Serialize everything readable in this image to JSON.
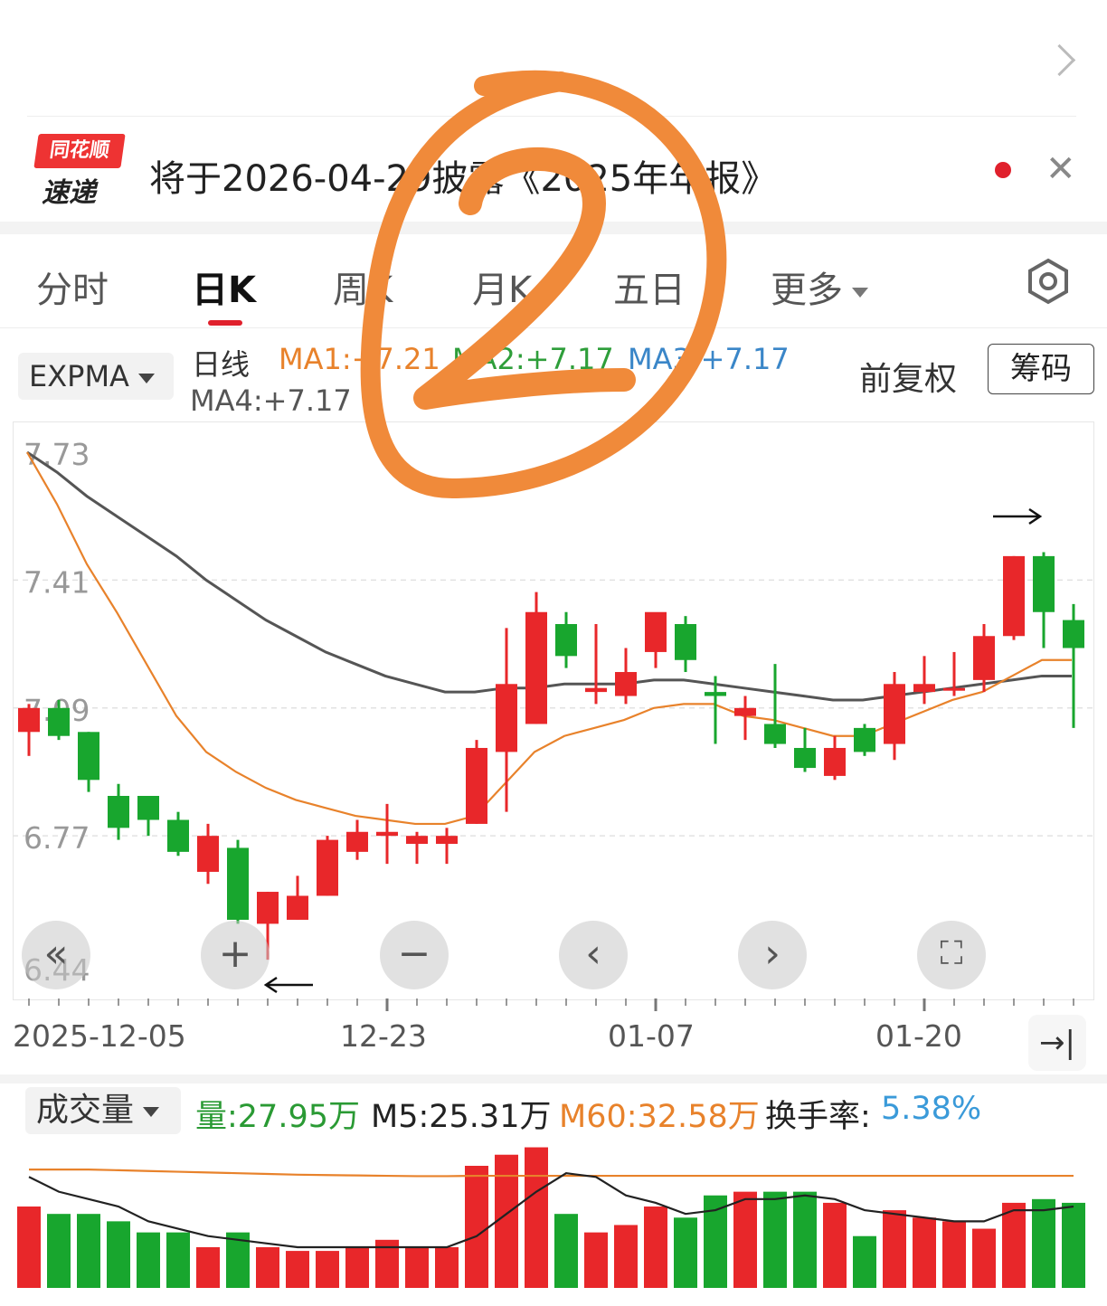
{
  "news": {
    "logo_top": "同花顺",
    "logo_bottom": "速递",
    "text": "将于2026-04-29披露《2025年年报》",
    "close": "✕"
  },
  "tabs": [
    "分时",
    "日K",
    "周K",
    "月K",
    "五日",
    "更多"
  ],
  "active_tab": "日K",
  "indicator": {
    "name": "EXPMA",
    "label": "日线",
    "ma1": "MA1:+7.21",
    "ma2": "MA2:+7.17",
    "ma3": "MA3:+7.17",
    "ma4": "MA4:+7.17",
    "adjust": "前复权",
    "chips_button": "筹码"
  },
  "colors": {
    "up": "#e8272a",
    "down": "#18a62e",
    "ma1": "#e8822b",
    "ma_dark": "#555555",
    "annotation": "#f08a3a"
  },
  "icons": [
    "gear-icon",
    "chevron-right-icon",
    "close-icon",
    "jump-to-end-icon"
  ],
  "controls": [
    "«",
    "+",
    "−",
    "‹",
    "›",
    "⛶"
  ],
  "chart_data": [
    {
      "type": "candlestick",
      "y_ticks": [
        "7.73",
        "7.41",
        "7.09",
        "6.77",
        "6.44"
      ],
      "ylim": [
        6.44,
        7.73
      ],
      "x_labels": [
        "2025-12-05",
        "12-23",
        "01-07",
        "01-20"
      ],
      "candles": [
        {
          "o": 7.03,
          "h": 7.1,
          "l": 6.97,
          "c": 7.09
        },
        {
          "o": 7.09,
          "h": 7.11,
          "l": 7.01,
          "c": 7.02
        },
        {
          "o": 7.03,
          "h": 7.03,
          "l": 6.88,
          "c": 6.91
        },
        {
          "o": 6.87,
          "h": 6.9,
          "l": 6.76,
          "c": 6.79
        },
        {
          "o": 6.87,
          "h": 6.87,
          "l": 6.77,
          "c": 6.81
        },
        {
          "o": 6.81,
          "h": 6.83,
          "l": 6.72,
          "c": 6.73
        },
        {
          "o": 6.68,
          "h": 6.8,
          "l": 6.65,
          "c": 6.77
        },
        {
          "o": 6.74,
          "h": 6.76,
          "l": 6.55,
          "c": 6.56
        },
        {
          "o": 6.55,
          "h": 6.63,
          "l": 6.46,
          "c": 6.63
        },
        {
          "o": 6.56,
          "h": 6.67,
          "l": 6.56,
          "c": 6.62
        },
        {
          "o": 6.62,
          "h": 6.77,
          "l": 6.62,
          "c": 6.76
        },
        {
          "o": 6.73,
          "h": 6.81,
          "l": 6.71,
          "c": 6.78
        },
        {
          "o": 6.77,
          "h": 6.85,
          "l": 6.7,
          "c": 6.78
        },
        {
          "o": 6.75,
          "h": 6.78,
          "l": 6.7,
          "c": 6.77
        },
        {
          "o": 6.75,
          "h": 6.79,
          "l": 6.7,
          "c": 6.77
        },
        {
          "o": 6.8,
          "h": 7.01,
          "l": 6.8,
          "c": 6.99
        },
        {
          "o": 6.98,
          "h": 7.29,
          "l": 6.83,
          "c": 7.15
        },
        {
          "o": 7.05,
          "h": 7.38,
          "l": 7.05,
          "c": 7.33
        },
        {
          "o": 7.3,
          "h": 7.33,
          "l": 7.19,
          "c": 7.22
        },
        {
          "o": 7.13,
          "h": 7.3,
          "l": 7.1,
          "c": 7.14
        },
        {
          "o": 7.12,
          "h": 7.24,
          "l": 7.1,
          "c": 7.18
        },
        {
          "o": 7.23,
          "h": 7.32,
          "l": 7.19,
          "c": 7.33
        },
        {
          "o": 7.3,
          "h": 7.32,
          "l": 7.18,
          "c": 7.21
        },
        {
          "o": 7.13,
          "h": 7.17,
          "l": 7.0,
          "c": 7.12
        },
        {
          "o": 7.07,
          "h": 7.12,
          "l": 7.01,
          "c": 7.09
        },
        {
          "o": 7.05,
          "h": 7.2,
          "l": 6.99,
          "c": 7.0
        },
        {
          "o": 6.99,
          "h": 7.04,
          "l": 6.93,
          "c": 6.94
        },
        {
          "o": 6.92,
          "h": 7.02,
          "l": 6.91,
          "c": 6.99
        },
        {
          "o": 7.04,
          "h": 7.05,
          "l": 6.97,
          "c": 6.98
        },
        {
          "o": 7.0,
          "h": 7.18,
          "l": 6.96,
          "c": 7.15
        },
        {
          "o": 7.13,
          "h": 7.22,
          "l": 7.1,
          "c": 7.15
        },
        {
          "o": 7.14,
          "h": 7.23,
          "l": 7.12,
          "c": 7.14
        },
        {
          "o": 7.16,
          "h": 7.3,
          "l": 7.13,
          "c": 7.27
        },
        {
          "o": 7.27,
          "h": 7.47,
          "l": 7.26,
          "c": 7.47
        },
        {
          "o": 7.47,
          "h": 7.48,
          "l": 7.24,
          "c": 7.33
        },
        {
          "o": 7.31,
          "h": 7.35,
          "l": 7.04,
          "c": 7.24
        }
      ],
      "ma1": [
        7.73,
        7.6,
        7.45,
        7.33,
        7.2,
        7.07,
        6.98,
        6.93,
        6.89,
        6.86,
        6.84,
        6.82,
        6.81,
        6.8,
        6.8,
        6.82,
        6.9,
        6.98,
        7.02,
        7.04,
        7.06,
        7.09,
        7.1,
        7.1,
        7.07,
        7.06,
        7.04,
        7.02,
        7.02,
        7.05,
        7.08,
        7.11,
        7.13,
        7.17,
        7.21,
        7.21
      ],
      "ma_dark": [
        7.73,
        7.68,
        7.62,
        7.57,
        7.52,
        7.47,
        7.41,
        7.36,
        7.31,
        7.27,
        7.23,
        7.2,
        7.17,
        7.15,
        7.13,
        7.13,
        7.14,
        7.14,
        7.15,
        7.15,
        7.15,
        7.16,
        7.16,
        7.15,
        7.14,
        7.13,
        7.12,
        7.11,
        7.11,
        7.12,
        7.13,
        7.14,
        7.15,
        7.16,
        7.17,
        7.17
      ]
    },
    {
      "type": "bar",
      "title": "成交量",
      "volume": "量:27.95万",
      "m5": "M5:25.31万",
      "m60": "M60:32.58万",
      "turnover_label": "换手率:",
      "turnover_value": "5.38%",
      "volumes": [
        22,
        20,
        20,
        18,
        15,
        15,
        11,
        15,
        11,
        10,
        10,
        11,
        13,
        11,
        11,
        33,
        36,
        38,
        20,
        15,
        17,
        22,
        19,
        25,
        26,
        26,
        26,
        23,
        14,
        21,
        19,
        18,
        16,
        23,
        24,
        23
      ],
      "m5_line": [
        30,
        26,
        24,
        22,
        18,
        16,
        14,
        13,
        12,
        11,
        11,
        11,
        11,
        11,
        11,
        14,
        20,
        26,
        31,
        30,
        25,
        23,
        20,
        21,
        24,
        24,
        25,
        24,
        21,
        20,
        19,
        18,
        18,
        21,
        21,
        22
      ],
      "m60_line": [
        32,
        32,
        32,
        31.8,
        31.6,
        31.4,
        31.2,
        31,
        30.8,
        30.6,
        30.5,
        30.4,
        30.3,
        30.2,
        30.2,
        30.3,
        30.3,
        30.3,
        30.3,
        30.3,
        30.3,
        30.3,
        30.3,
        30.3,
        30.3,
        30.3,
        30.3,
        30.3,
        30.3,
        30.3,
        30.3,
        30.3,
        30.3,
        30.3,
        30.3,
        30.3
      ],
      "ymax": 44
    }
  ]
}
